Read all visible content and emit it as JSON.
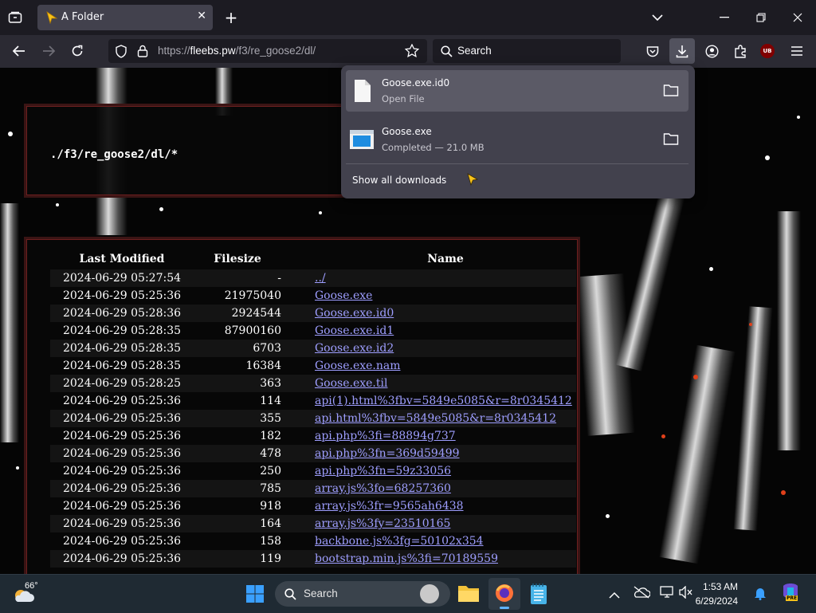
{
  "browser": {
    "tab_title": "A Folder",
    "url_scheme": "https://",
    "url_host": "fleebs.pw",
    "url_path": "/f3/re_goose2/dl/",
    "search_placeholder": "Search",
    "addon_badge": "UB"
  },
  "downloads": {
    "items": [
      {
        "name": "Goose.exe.id0",
        "status": "Open File"
      },
      {
        "name": "Goose.exe",
        "status": "Completed — 21.0 MB"
      }
    ],
    "show_all": "Show all downloads"
  },
  "page": {
    "path_title": "./f3/re_goose2/dl/*",
    "columns": [
      "Last Modified",
      "Filesize",
      "Name"
    ],
    "rows": [
      {
        "date": "2024-06-29 05:27:54",
        "size": "-",
        "name": "../"
      },
      {
        "date": "2024-06-29 05:25:36",
        "size": "21975040",
        "name": "Goose.exe"
      },
      {
        "date": "2024-06-29 05:28:36",
        "size": "2924544",
        "name": "Goose.exe.id0"
      },
      {
        "date": "2024-06-29 05:28:35",
        "size": "87900160",
        "name": "Goose.exe.id1"
      },
      {
        "date": "2024-06-29 05:28:35",
        "size": "6703",
        "name": "Goose.exe.id2"
      },
      {
        "date": "2024-06-29 05:28:35",
        "size": "16384",
        "name": "Goose.exe.nam"
      },
      {
        "date": "2024-06-29 05:28:25",
        "size": "363",
        "name": "Goose.exe.til"
      },
      {
        "date": "2024-06-29 05:25:36",
        "size": "114",
        "name": "api(1).html%3fbv=5849e5085&r=8r0345412"
      },
      {
        "date": "2024-06-29 05:25:36",
        "size": "355",
        "name": "api.html%3fbv=5849e5085&r=8r0345412"
      },
      {
        "date": "2024-06-29 05:25:36",
        "size": "182",
        "name": "api.php%3fi=88894g737"
      },
      {
        "date": "2024-06-29 05:25:36",
        "size": "478",
        "name": "api.php%3fn=369d59499"
      },
      {
        "date": "2024-06-29 05:25:36",
        "size": "250",
        "name": "api.php%3fn=59z33056"
      },
      {
        "date": "2024-06-29 05:25:36",
        "size": "785",
        "name": "array.js%3fo=68257360"
      },
      {
        "date": "2024-06-29 05:25:36",
        "size": "918",
        "name": "array.js%3fr=9565ah6438"
      },
      {
        "date": "2024-06-29 05:25:36",
        "size": "164",
        "name": "array.js%3fy=23510165"
      },
      {
        "date": "2024-06-29 05:25:36",
        "size": "158",
        "name": "backbone.js%3fg=50102x354"
      },
      {
        "date": "2024-06-29 05:25:36",
        "size": "119",
        "name": "bootstrap.min.js%3fi=70189559"
      }
    ]
  },
  "taskbar": {
    "weather_temp": "66°",
    "search_label": "Search",
    "time": "1:53 AM",
    "date": "6/29/2024",
    "copilot_badge": "PRE"
  },
  "colors": {
    "link": "#9e9eff",
    "accent_cursor": "#f7c21a",
    "tab_bg": "#42414d",
    "toolbar_bg": "#2b2a33"
  }
}
